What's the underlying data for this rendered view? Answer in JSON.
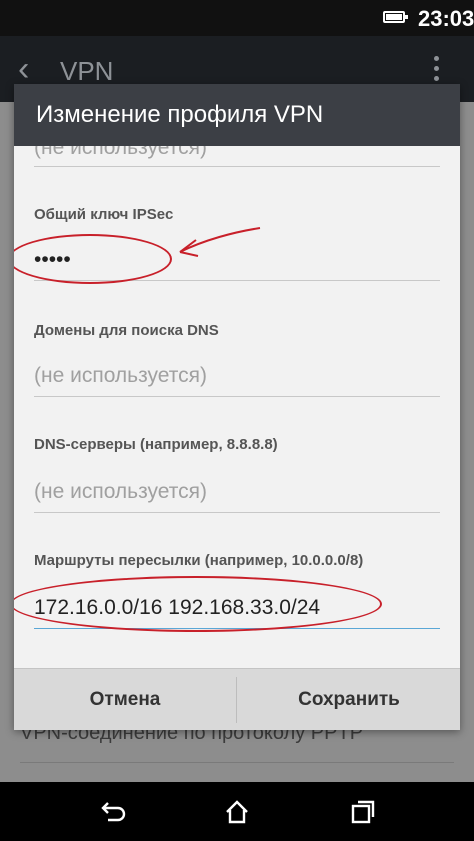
{
  "status_bar": {
    "time": "23:03"
  },
  "app_bar": {
    "title": "VPN"
  },
  "background": {
    "list_item": "VPN-соединение по протоколу PPTP"
  },
  "dialog": {
    "title": "Изменение профиля VPN",
    "fields": {
      "top_partial": {
        "value": "(не используется)"
      },
      "ipsec_key": {
        "label": "Общий ключ IPSec",
        "value": "•••••"
      },
      "dns_search": {
        "label": "Домены для поиска DNS",
        "placeholder": "(не используется)"
      },
      "dns_servers": {
        "label": "DNS-серверы (например, 8.8.8.8)",
        "placeholder": "(не используется)"
      },
      "routes": {
        "label": "Маршруты пересылки (например, 10.0.0.0/8)",
        "value": "172.16.0.0/16 192.168.33.0/24"
      }
    },
    "buttons": {
      "cancel": "Отмена",
      "save": "Сохранить"
    }
  },
  "colors": {
    "annotation": "#c8202a",
    "accent_underline": "#5aa7d6",
    "dialog_header": "#3c3f45"
  }
}
